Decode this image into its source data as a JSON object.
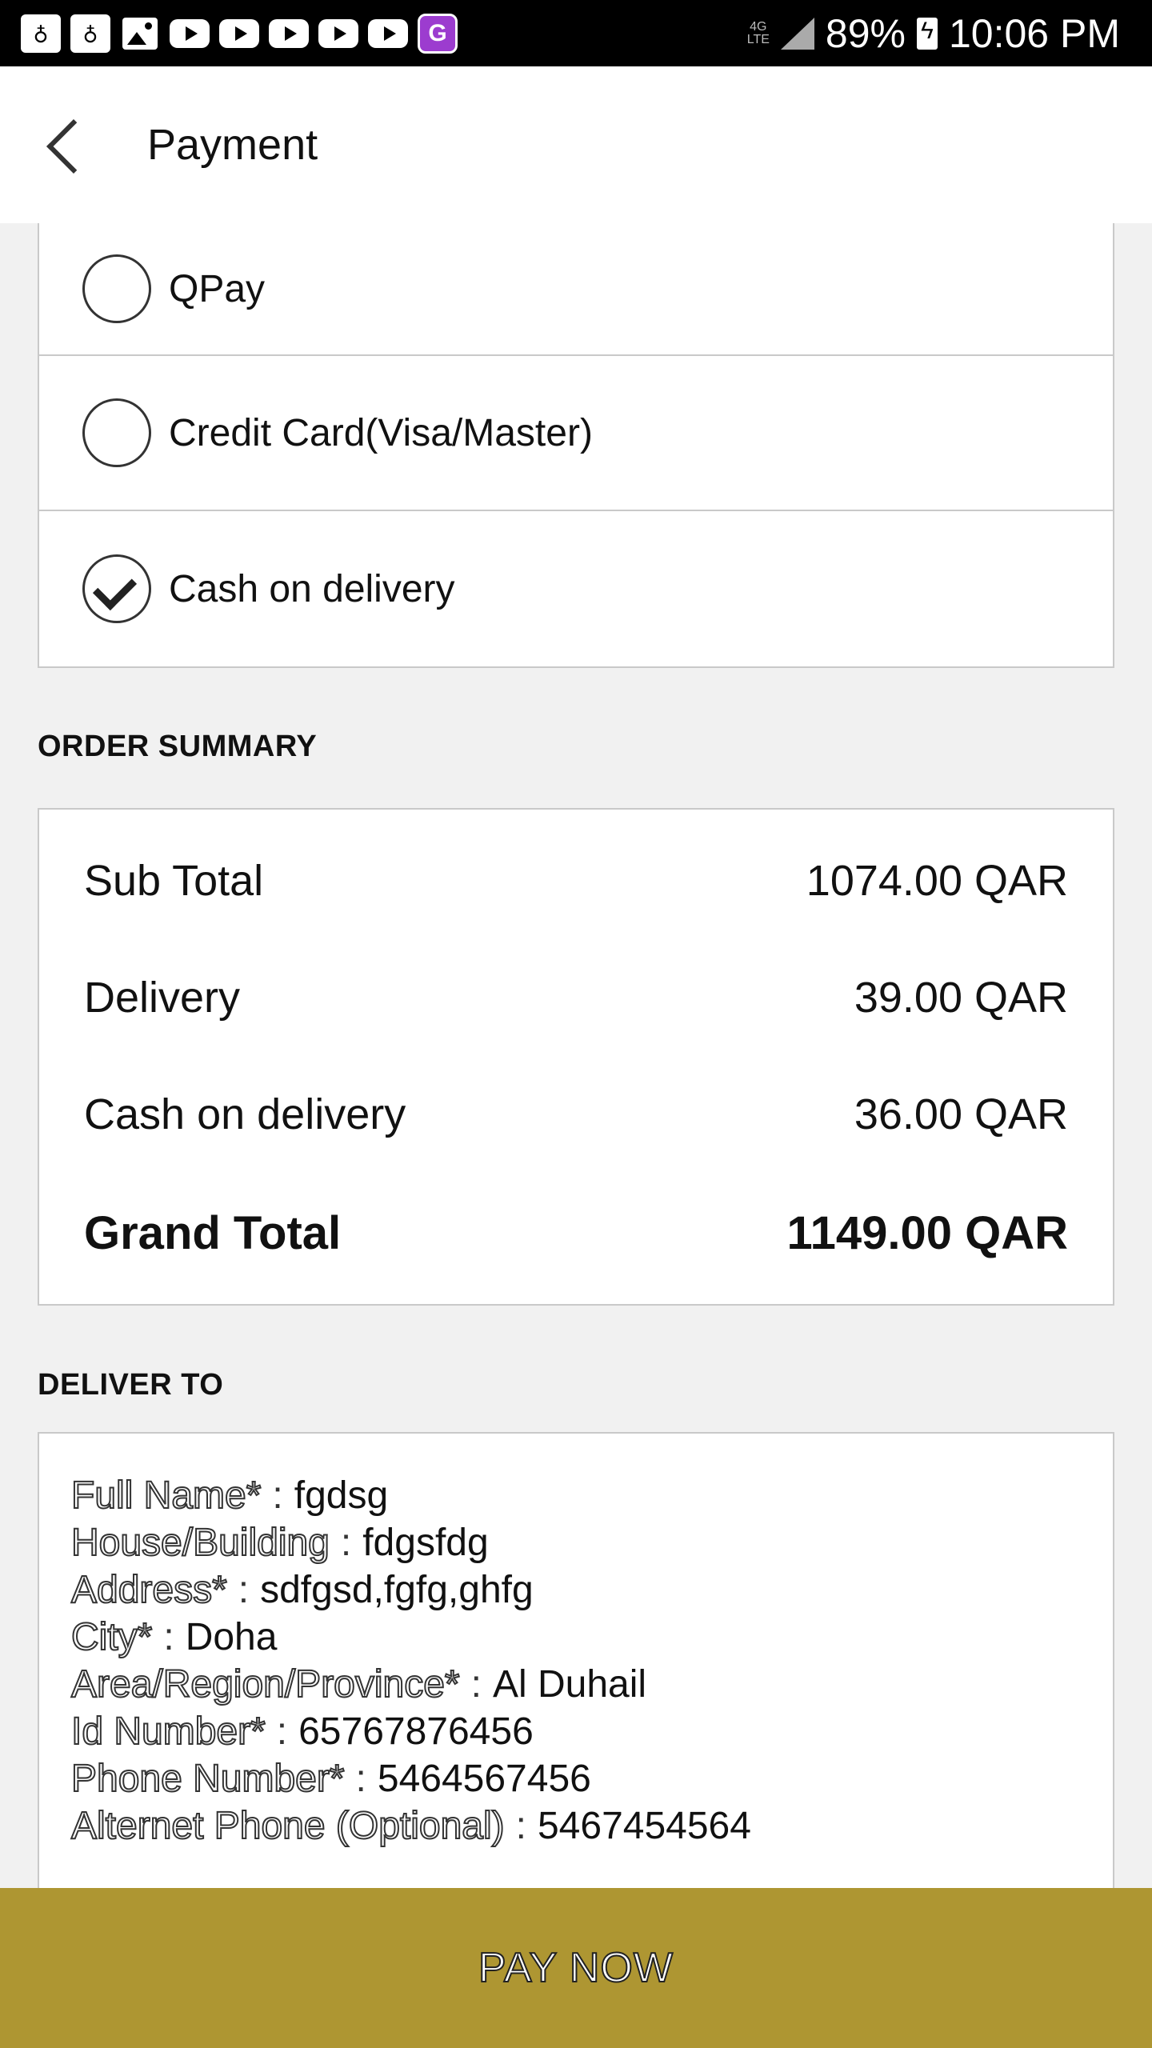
{
  "status_bar": {
    "battery": "89%",
    "time": "10:06 PM",
    "network": "4G LTE",
    "notification_icons": [
      "app-icon",
      "app-icon",
      "image-icon",
      "youtube-icon",
      "youtube-icon",
      "youtube-icon",
      "youtube-icon",
      "youtube-icon",
      "g-app-icon"
    ]
  },
  "header": {
    "title": "Payment"
  },
  "payment_methods": [
    {
      "label": "QPay",
      "selected": false
    },
    {
      "label": "Credit Card(Visa/Master)",
      "selected": false
    },
    {
      "label": "Cash on delivery",
      "selected": true
    }
  ],
  "order_summary": {
    "title": "ORDER SUMMARY",
    "rows": [
      {
        "label": "Sub Total",
        "value": "1074.00 QAR"
      },
      {
        "label": "Delivery",
        "value": "39.00 QAR"
      },
      {
        "label": "Cash on delivery",
        "value": "36.00 QAR"
      }
    ],
    "grand_total": {
      "label": "Grand Total",
      "value": "1149.00 QAR"
    }
  },
  "deliver_to": {
    "title": "DELIVER TO",
    "fields": [
      {
        "key": "Full Name*",
        "value": "fgdsg"
      },
      {
        "key": "House/Building",
        "value": "fdgsfdg"
      },
      {
        "key": "Address*",
        "value": "sdfgsd,fgfg,ghfg"
      },
      {
        "key": "City*",
        "value": "Doha"
      },
      {
        "key": "Area/Region/Province*",
        "value": "Al Duhail"
      },
      {
        "key": "Id Number*",
        "value": "65767876456"
      },
      {
        "key": "Phone Number*",
        "value": "5464567456"
      },
      {
        "key": "Alternet Phone (Optional)",
        "value": "5467454564"
      }
    ],
    "separator": ":"
  },
  "pay_button": {
    "label": "PAY NOW"
  },
  "colors": {
    "accent": "#ae9632",
    "background": "#f1f1f1",
    "border": "#c9c9c9"
  }
}
